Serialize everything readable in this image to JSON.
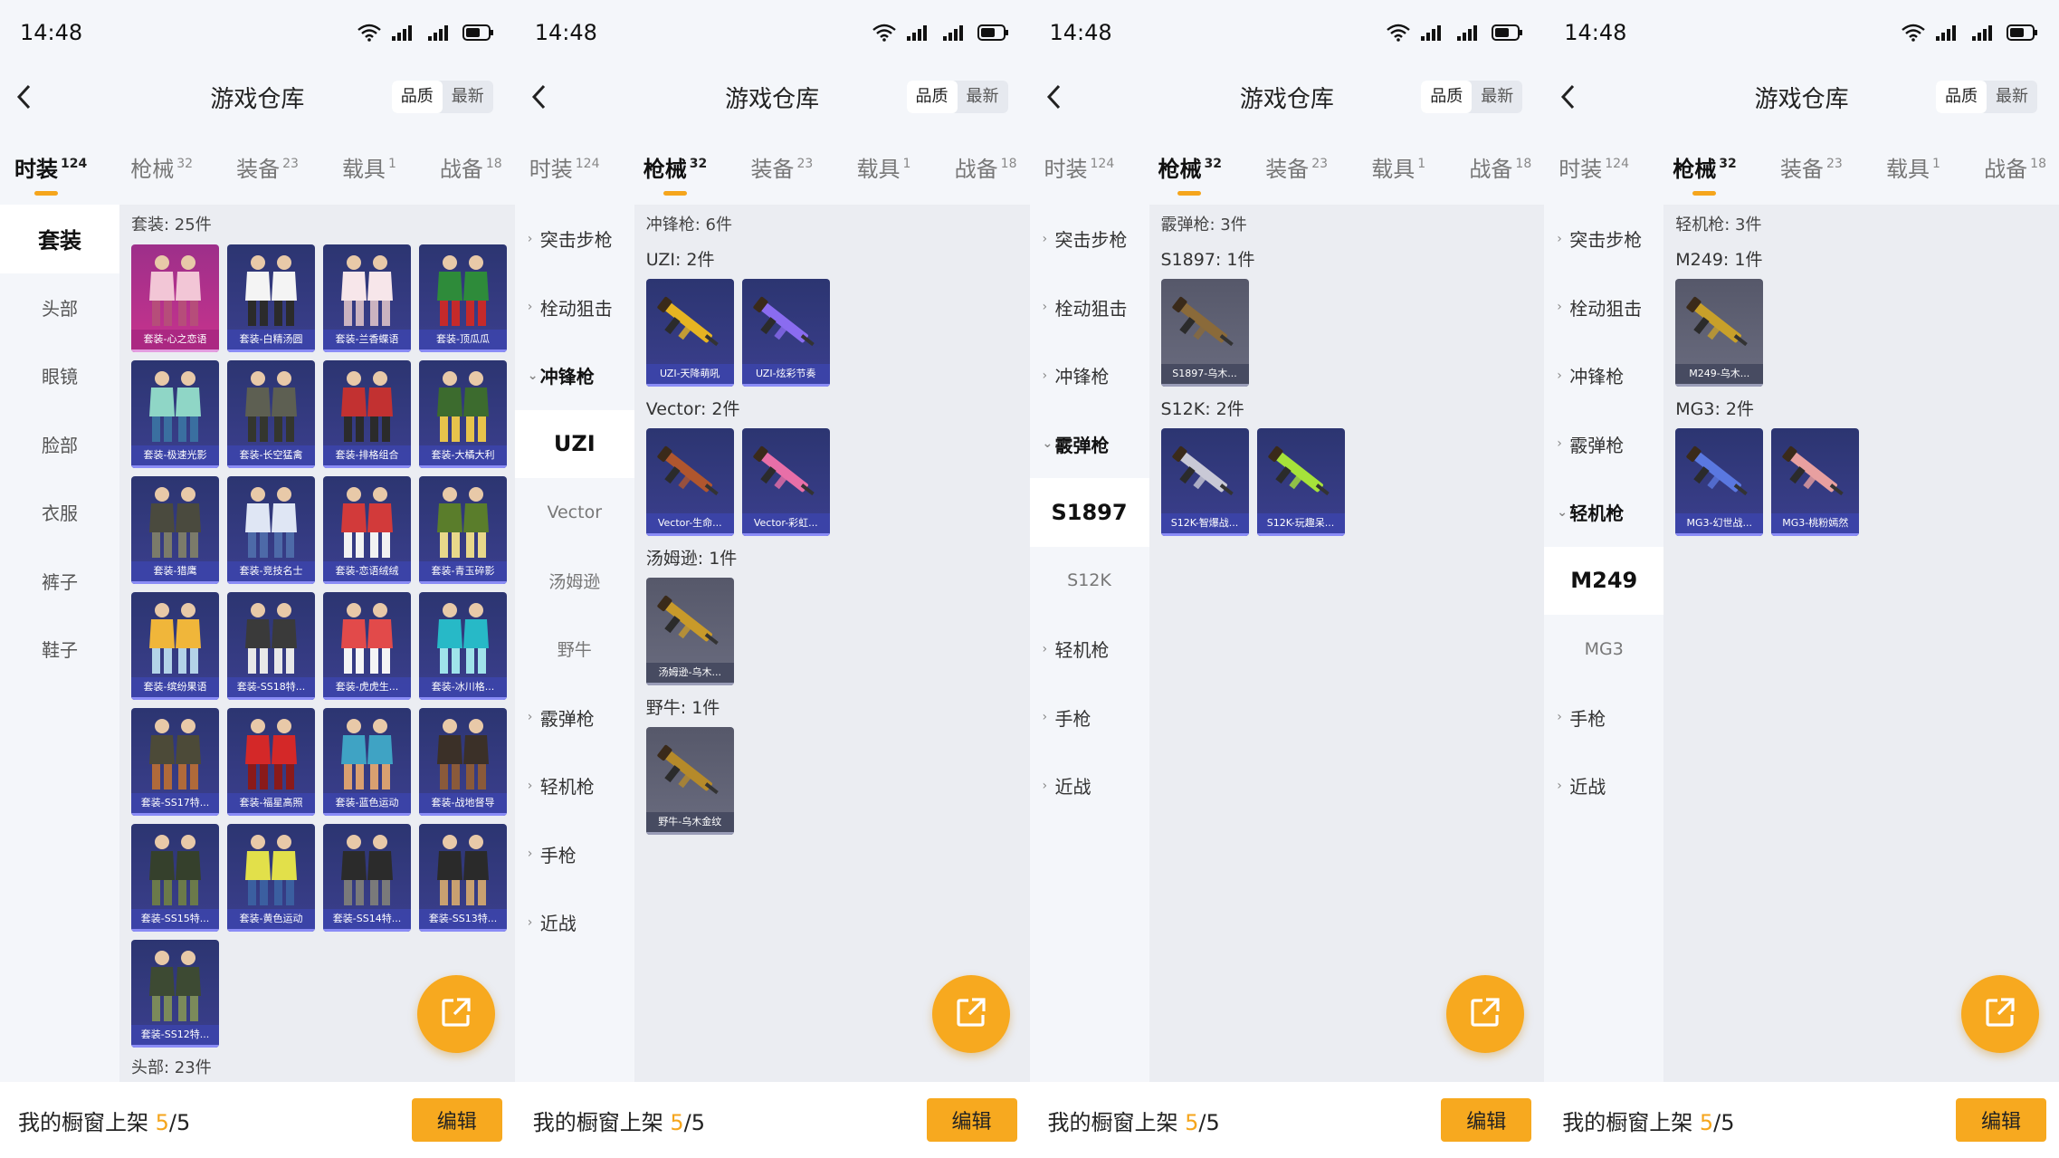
{
  "status": {
    "time": "14:48"
  },
  "header": {
    "title": "游戏仓库",
    "sort_quality": "品质",
    "sort_latest": "最新"
  },
  "tabs": [
    {
      "label": "时装",
      "count": "124"
    },
    {
      "label": "枪械",
      "count": "32"
    },
    {
      "label": "装备",
      "count": "23"
    },
    {
      "label": "载具",
      "count": "1"
    },
    {
      "label": "战备",
      "count": "18"
    }
  ],
  "footer": {
    "prefix": "我的橱窗上架 ",
    "num": "5",
    "total": "/5",
    "edit_label": "编辑"
  },
  "colors": {
    "accent": "#f7a91f",
    "card_blue": "#3b3f8e",
    "card_pink": "#c8338d"
  },
  "panel1": {
    "categories": [
      "套装",
      "头部",
      "眼镜",
      "脸部",
      "衣服",
      "裤子",
      "鞋子"
    ],
    "count_label": "套装: 25件",
    "next_label": "头部: 23件",
    "items": [
      "套装-心之恋语",
      "套装-白精汤圆",
      "套装-兰香蝶语",
      "套装-顶瓜瓜",
      "套装-极速光影",
      "套装-长空猛禽",
      "套装-排格组合",
      "套装-大橘大利",
      "套装-猎鹰",
      "套装-竞技名士",
      "套装-恋语绒绒",
      "套装-青玉碎影",
      "套装-缤纷果语",
      "套装-SS18特...",
      "套装-虎虎生...",
      "套装-冰川格...",
      "套装-SS17特...",
      "套装-福星高照",
      "套装-蓝色运动",
      "套装-战地督导",
      "套装-SS15特...",
      "套装-黄色运动",
      "套装-SS14特...",
      "套装-SS13特...",
      "套装-SS12特..."
    ]
  },
  "gun_menu": {
    "ar": "突击步枪",
    "sniper": "栓动狙击",
    "smg": "冲锋枪",
    "shotgun": "霰弹枪",
    "lmg": "轻机枪",
    "pistol": "手枪",
    "melee": "近战"
  },
  "panel2": {
    "subs": [
      "UZI",
      "Vector",
      "汤姆逊",
      "野牛"
    ],
    "count_label": "冲锋枪: 6件",
    "groups": [
      {
        "label": "UZI: 2件",
        "items": [
          "UZI-天降萌吼",
          "UZI-炫彩节奏"
        ]
      },
      {
        "label": "Vector: 2件",
        "items": [
          "Vector-生命...",
          "Vector-彩虹..."
        ]
      },
      {
        "label": "汤姆逊: 1件",
        "items": [
          "汤姆逊-乌木..."
        ]
      },
      {
        "label": "野牛: 1件",
        "items": [
          "野牛-乌木金纹"
        ]
      }
    ]
  },
  "panel3": {
    "subs": [
      "S1897",
      "S12K"
    ],
    "count_label": "霰弹枪: 3件",
    "groups": [
      {
        "label": "S1897: 1件",
        "items": [
          "S1897-乌木..."
        ]
      },
      {
        "label": "S12K: 2件",
        "items": [
          "S12K-智爆战...",
          "S12K-玩趣呆..."
        ]
      }
    ]
  },
  "panel4": {
    "subs": [
      "M249",
      "MG3"
    ],
    "count_label": "轻机枪: 3件",
    "groups": [
      {
        "label": "M249: 1件",
        "items": [
          "M249-乌木..."
        ]
      },
      {
        "label": "MG3: 2件",
        "items": [
          "MG3-幻世战...",
          "MG3-桃粉嫣然"
        ]
      }
    ]
  }
}
